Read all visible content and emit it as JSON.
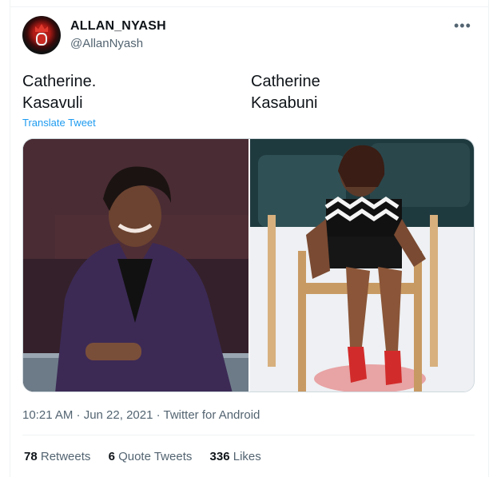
{
  "tweet": {
    "display_name": "ALLAN_NYASH",
    "handle": "@AllanNyash",
    "more_icon": "more-horizontal-icon",
    "text_left": "Catherine.\nKasavuli",
    "text_right": "Catherine\n Kasabuni",
    "translate_label": "Translate Tweet",
    "timestamp": "10:21 AM · Jun 22, 2021 · Twitter for Android",
    "stats": {
      "retweets_count": "78",
      "retweets_label": "Retweets",
      "quotes_count": "6",
      "quotes_label": "Quote Tweets",
      "likes_count": "336",
      "likes_label": "Likes"
    }
  },
  "colors": {
    "link": "#1d9bf0",
    "secondary_text": "#536471",
    "border": "#eff3f4"
  }
}
